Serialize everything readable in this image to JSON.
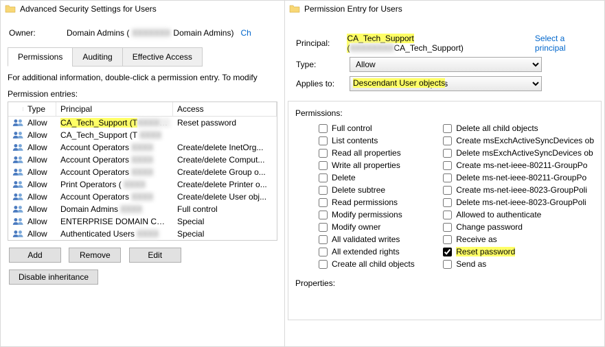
{
  "left": {
    "title": "Advanced Security Settings for Users",
    "owner_label": "Owner:",
    "owner_prefix": "Domain Admins (",
    "owner_redacted": "XXXXXXX",
    "owner_suffix": "Domain Admins)",
    "change_link": "Ch",
    "tabs": {
      "permissions": "Permissions",
      "auditing": "Auditing",
      "effective": "Effective Access"
    },
    "info_text": "For additional information, double-click a permission entry. To modify",
    "entries_label": "Permission entries:",
    "headers": {
      "type": "Type",
      "principal": "Principal",
      "access": "Access"
    },
    "rows": [
      {
        "type": "Allow",
        "principal": "CA_Tech_Support (T",
        "access": "Reset password",
        "hl": true
      },
      {
        "type": "Allow",
        "principal": "CA_Tech_Support (T",
        "access": ""
      },
      {
        "type": "Allow",
        "principal": "Account Operators",
        "access": "Create/delete InetOrg..."
      },
      {
        "type": "Allow",
        "principal": "Account Operators",
        "access": "Create/delete Comput..."
      },
      {
        "type": "Allow",
        "principal": "Account Operators",
        "access": "Create/delete Group o..."
      },
      {
        "type": "Allow",
        "principal": "Print Operators (",
        "access": "Create/delete Printer o..."
      },
      {
        "type": "Allow",
        "principal": "Account Operators",
        "access": "Create/delete User obj..."
      },
      {
        "type": "Allow",
        "principal": "Domain Admins",
        "access": "Full control"
      },
      {
        "type": "Allow",
        "principal": "ENTERPRISE DOMAIN CONT...",
        "access": "Special"
      },
      {
        "type": "Allow",
        "principal": "Authenticated Users",
        "access": "Special"
      }
    ],
    "buttons": {
      "add": "Add",
      "remove": "Remove",
      "edit": "Edit",
      "disable": "Disable inheritance"
    }
  },
  "right": {
    "title": "Permission Entry for Users",
    "principal_label": "Principal:",
    "principal_prefix": "CA_Tech_Support (",
    "principal_redacted": "XXXXXXXX",
    "principal_suffix": "CA_Tech_Support)",
    "select_principal": "Select a principal",
    "type_label": "Type:",
    "type_value": "Allow",
    "applies_label": "Applies to:",
    "applies_value": "Descendant User objects",
    "permissions_label": "Permissions:",
    "properties_label": "Properties:",
    "col1": [
      {
        "label": "Full control",
        "checked": false
      },
      {
        "label": "List contents",
        "checked": false
      },
      {
        "label": "Read all properties",
        "checked": false
      },
      {
        "label": "Write all properties",
        "checked": false
      },
      {
        "label": "Delete",
        "checked": false
      },
      {
        "label": "Delete subtree",
        "checked": false
      },
      {
        "label": "Read permissions",
        "checked": false
      },
      {
        "label": "Modify permissions",
        "checked": false
      },
      {
        "label": "Modify owner",
        "checked": false
      },
      {
        "label": "All validated writes",
        "checked": false
      },
      {
        "label": "All extended rights",
        "checked": false
      },
      {
        "label": "Create all child objects",
        "checked": false
      }
    ],
    "col2": [
      {
        "label": "Delete all child objects",
        "checked": false
      },
      {
        "label": "Create msExchActiveSyncDevices ob",
        "checked": false
      },
      {
        "label": "Delete msExchActiveSyncDevices ob",
        "checked": false
      },
      {
        "label": "Create ms-net-ieee-80211-GroupPo",
        "checked": false
      },
      {
        "label": "Delete ms-net-ieee-80211-GroupPo",
        "checked": false
      },
      {
        "label": "Create ms-net-ieee-8023-GroupPoli",
        "checked": false
      },
      {
        "label": "Delete ms-net-ieee-8023-GroupPoli",
        "checked": false
      },
      {
        "label": "Allowed to authenticate",
        "checked": false
      },
      {
        "label": "Change password",
        "checked": false
      },
      {
        "label": "Receive as",
        "checked": false
      },
      {
        "label": "Reset password",
        "checked": true,
        "hl": true
      },
      {
        "label": "Send as",
        "checked": false
      }
    ]
  }
}
